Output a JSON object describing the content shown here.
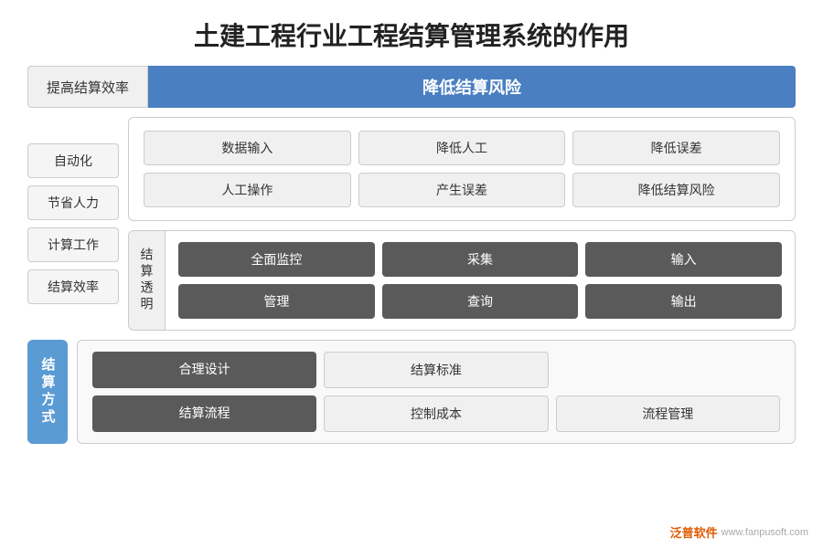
{
  "title": "土建工程行业工程结算管理系统的作用",
  "header": {
    "left_label": "提高结算效率",
    "right_label": "降低结算风险"
  },
  "left_items": [
    "自动化",
    "节省人力",
    "计算工作",
    "结算效率"
  ],
  "top_panel": {
    "tags": [
      {
        "text": "数据输入",
        "style": "light"
      },
      {
        "text": "降低人工",
        "style": "light"
      },
      {
        "text": "降低误差",
        "style": "light"
      },
      {
        "text": "人工操作",
        "style": "light"
      },
      {
        "text": "产生误差",
        "style": "light"
      },
      {
        "text": "降低结算风险",
        "style": "light"
      }
    ]
  },
  "bottom_panel": {
    "label": "结算透明",
    "tags": [
      {
        "text": "全面监控",
        "style": "dark"
      },
      {
        "text": "采集",
        "style": "dark"
      },
      {
        "text": "输入",
        "style": "dark"
      },
      {
        "text": "管理",
        "style": "dark"
      },
      {
        "text": "查询",
        "style": "dark"
      },
      {
        "text": "输出",
        "style": "dark"
      }
    ]
  },
  "bottom_section": {
    "label": "结算方式",
    "tags": [
      {
        "text": "合理设计",
        "style": "dark",
        "col": 1,
        "row": 1
      },
      {
        "text": "结算标准",
        "style": "light",
        "col": 2,
        "row": 1
      },
      {
        "text": "",
        "style": "empty",
        "col": 3,
        "row": 1
      },
      {
        "text": "结算流程",
        "style": "dark",
        "col": 1,
        "row": 2
      },
      {
        "text": "控制成本",
        "style": "light",
        "col": 2,
        "row": 2
      },
      {
        "text": "流程管理",
        "style": "light",
        "col": 3,
        "row": 2
      }
    ]
  },
  "watermark": {
    "logo": "泛普软件",
    "url": "www.fanpusoft.com"
  }
}
